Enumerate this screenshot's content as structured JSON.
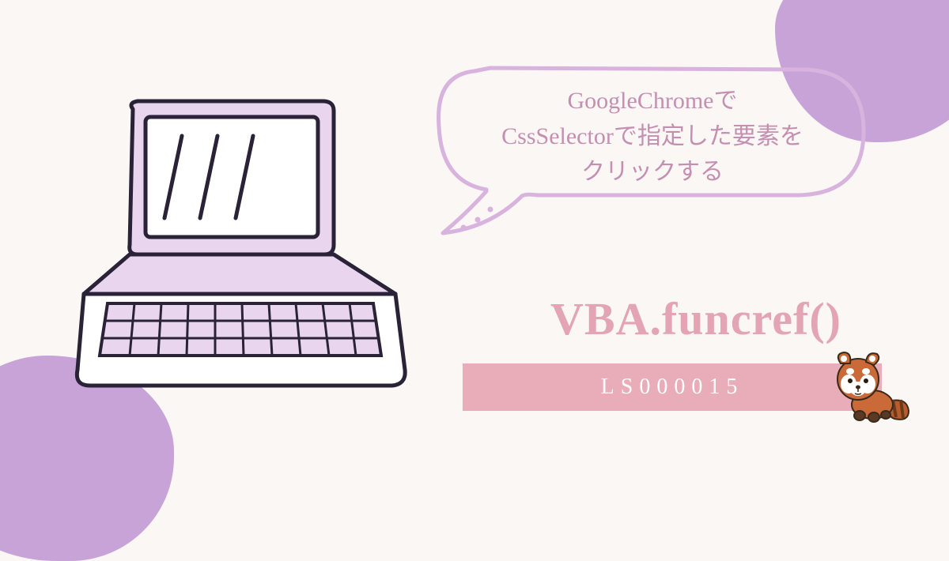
{
  "bubble": {
    "line1": "GoogleChromeで",
    "line2": "CssSelectorで指定した要素を",
    "line3": "クリックする"
  },
  "title": "VBA.funcref()",
  "code": "LS000015",
  "colors": {
    "blob": "#c8a3d8",
    "bubble_stroke": "#d8b3de",
    "bubble_text": "#c48fb0",
    "title": "#e3a4b3",
    "bar": "#e8adb8"
  }
}
